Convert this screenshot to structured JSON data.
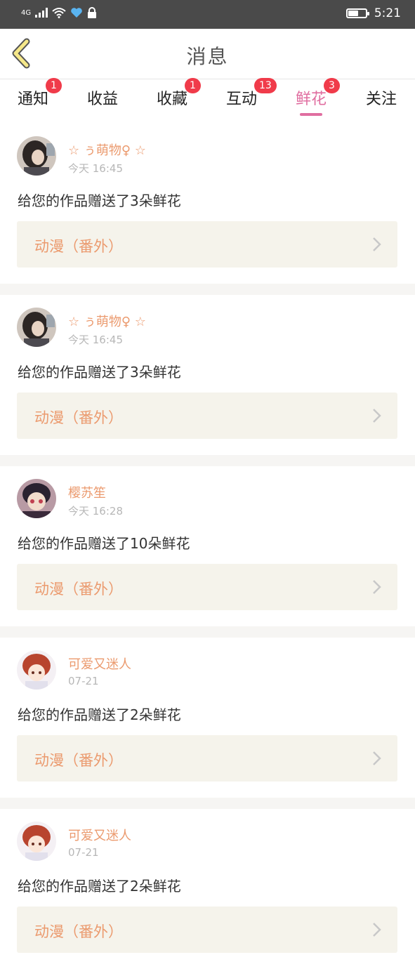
{
  "status_bar": {
    "network": "4G",
    "time": "5:21",
    "icons": [
      "signal-icon",
      "wifi-icon",
      "heart-app-icon",
      "lock-icon",
      "battery-icon"
    ]
  },
  "header": {
    "title": "消息",
    "back_icon": "chevron-left-icon"
  },
  "tabs": [
    {
      "label": "通知",
      "badge": "1"
    },
    {
      "label": "收益",
      "badge": ""
    },
    {
      "label": "收藏",
      "badge": "1"
    },
    {
      "label": "互动",
      "badge": "13"
    },
    {
      "label": "鲜花",
      "badge": "3",
      "active": true
    },
    {
      "label": "关注",
      "badge": ""
    }
  ],
  "colors": {
    "accent": "#e06ea0",
    "badge": "#f03b4a",
    "name": "#eb9a6e",
    "card_bg": "#f5f3eb"
  },
  "messages": [
    {
      "user": "☆ ぅ萌物♀ ☆",
      "time": "今天 16:45",
      "text": "给您的作品赠送了3朵鲜花",
      "work": "动漫（番外）"
    },
    {
      "user": "☆ ぅ萌物♀ ☆",
      "time": "今天 16:45",
      "text": "给您的作品赠送了3朵鲜花",
      "work": "动漫（番外）"
    },
    {
      "user": "樱苏笙",
      "time": "今天 16:28",
      "text": "给您的作品赠送了10朵鲜花",
      "work": "动漫（番外）"
    },
    {
      "user": "可爱又迷人",
      "time": "07-21",
      "text": "给您的作品赠送了2朵鲜花",
      "work": "动漫（番外）"
    },
    {
      "user": "可爱又迷人",
      "time": "07-21",
      "text": "给您的作品赠送了2朵鲜花",
      "work": "动漫（番外）"
    }
  ]
}
